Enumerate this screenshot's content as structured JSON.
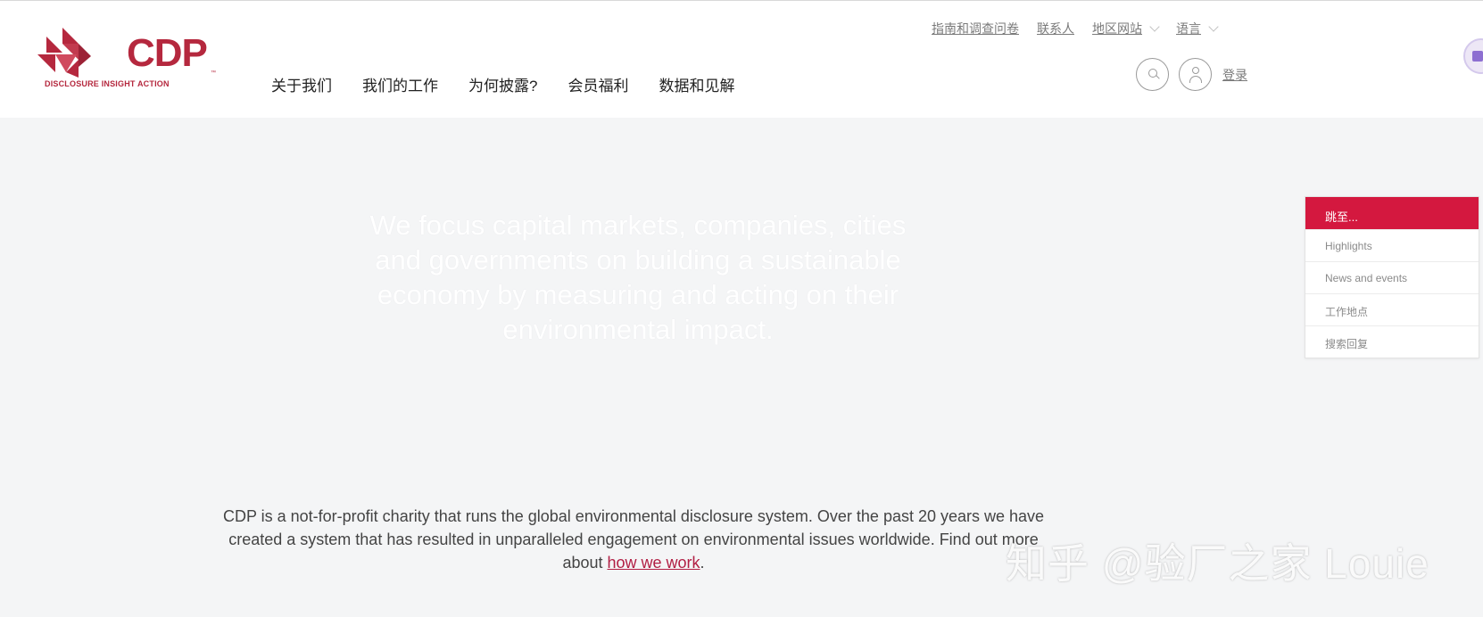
{
  "brand": {
    "name": "CDP",
    "tagline": "DISCLOSURE INSIGHT ACTION",
    "trademark": "™",
    "color": "#b5283e"
  },
  "util_nav": {
    "guides": "指南和调查问卷",
    "contact": "联系人",
    "region": "地区网站",
    "language": "语言"
  },
  "main_nav": [
    "关于我们",
    "我们的工作",
    "为何披露?",
    "会员福利",
    "数据和见解"
  ],
  "header_actions": {
    "search_icon": "search-icon",
    "user_icon": "user-icon",
    "login": "登录"
  },
  "hero": {
    "text": "We focus capital markets, companies, cities and governments on building a sustainable economy by measuring and acting on their environmental impact."
  },
  "jump_panel": {
    "title": "跳至...",
    "items": [
      "Highlights",
      "News and events",
      "工作地点",
      "搜索回复"
    ],
    "accent": "#d4183f"
  },
  "about": {
    "text": "CDP is a not-for-profit charity that runs the global environmental disclosure system. Over the past 20 years we have created a system that has resulted in unparalleled engagement on environmental issues worldwide. Find out more about ",
    "link": "how we work",
    "suffix": "."
  },
  "watermark": "知乎 @验厂之家 Louie"
}
